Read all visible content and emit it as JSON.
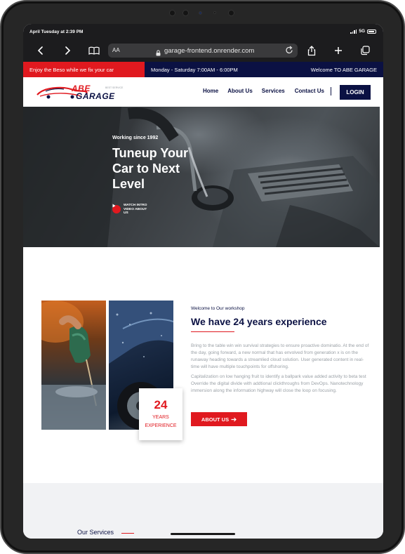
{
  "status_bar": {
    "time": "April Tuesday at 2:39 PM",
    "network": "5G"
  },
  "browser": {
    "text_size_label": "AA",
    "url": "garage-frontend.onrender.com"
  },
  "topbar": {
    "promo": "Enjoy the Beso while we fix your car",
    "hours": "Monday - Saturday 7:00AM - 6:00PM",
    "welcome": "Welcome TO ABE GARAGE"
  },
  "nav": {
    "logo_line1": "ABE",
    "logo_line2": "GARAGE",
    "logo_tag": "BEST SERVICE",
    "links": [
      "Home",
      "About Us",
      "Services",
      "Contact Us"
    ],
    "login": "LOGIN"
  },
  "hero": {
    "kicker": "Working since 1992",
    "title": "Tuneup Your Car to Next Level",
    "watch_label": "WATCH INTRO VIDEO ABOUT US"
  },
  "about": {
    "kicker": "Welcome to Our workshop",
    "title": "We have 24 years experience",
    "paragraph1": "Bring to the table win win survival strategies to ensure proactive dominatio. At the end of the day, going forward, a new normal that has envolved from generation x is on the runaway heading towards a streamlied cloud solution. User generated content in real-time will have multiple touchpoints for offshoring.",
    "paragraph2": "Capitalization on low hanging fruit to identify a ballpark value added activity to beta test Override the digital divide with addtional clickthroughs from DevOps. Nanotechnology immersion along the information highway will close the loop on focusing.",
    "years_number": "24",
    "years_label_1": "YEARS",
    "years_label_2": "EXPERIENCE",
    "button": "ABOUT US"
  },
  "services": {
    "heading": "Our Services"
  },
  "colors": {
    "brand_red": "#e0191f",
    "brand_navy": "#0b1143"
  }
}
